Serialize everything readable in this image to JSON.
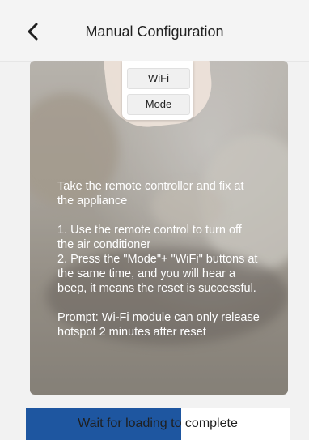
{
  "header": {
    "title": "Manual Configuration",
    "back_icon": "chevron-left-icon"
  },
  "card": {
    "remote": {
      "wifi_label": "WiFi",
      "mode_label": "Mode"
    },
    "intro": "Take the remote controller and fix at the appliance",
    "steps": [
      "1. Use the remote control to turn off the air conditioner",
      "2. Press the \"Mode\"+ \"WiFi\" buttons at the same time, and you will hear a beep, it means the reset is successful."
    ],
    "prompt": "Prompt: Wi-Fi module can only release hotspot 2 minutes after reset"
  },
  "footer": {
    "label": "Wait for loading to complete",
    "progress": 0.59,
    "progress_color": "#1e56a0"
  }
}
